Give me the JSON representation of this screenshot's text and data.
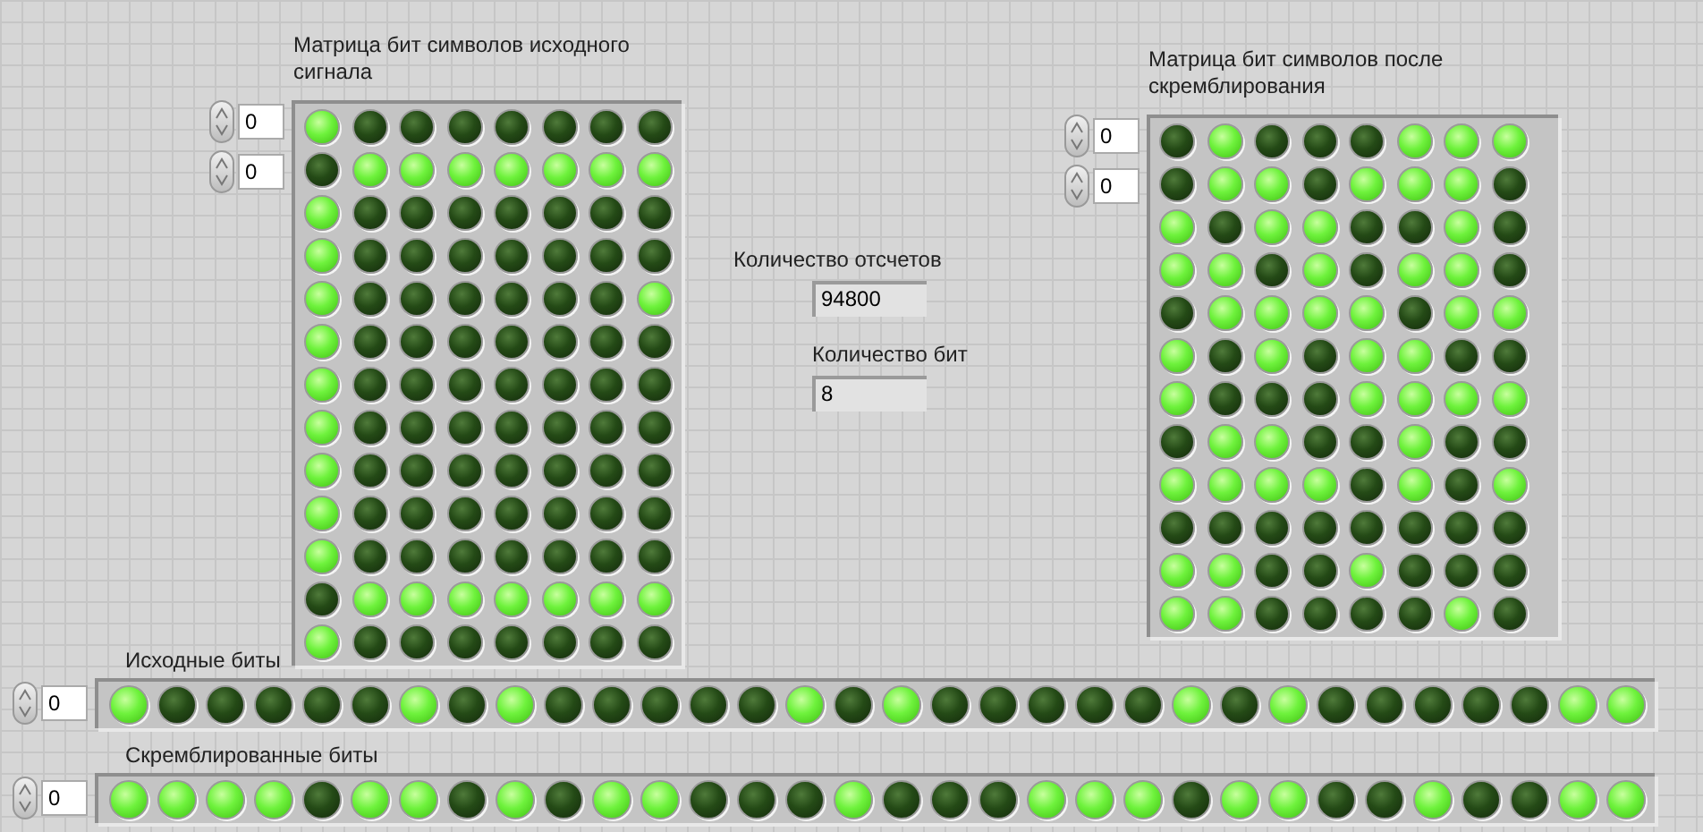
{
  "matrices": [
    {
      "label": "Матрица бит символов исходного сигнала",
      "index": [
        "0",
        "0"
      ],
      "rows": [
        [
          true,
          false,
          false,
          false,
          false,
          false,
          false,
          false
        ],
        [
          false,
          true,
          true,
          true,
          true,
          true,
          true,
          true
        ],
        [
          true,
          false,
          false,
          false,
          false,
          false,
          false,
          false
        ],
        [
          true,
          false,
          false,
          false,
          false,
          false,
          false,
          false
        ],
        [
          true,
          false,
          false,
          false,
          false,
          false,
          false,
          true
        ],
        [
          true,
          false,
          false,
          false,
          false,
          false,
          false,
          false
        ],
        [
          true,
          false,
          false,
          false,
          false,
          false,
          false,
          false
        ],
        [
          true,
          false,
          false,
          false,
          false,
          false,
          false,
          false
        ],
        [
          true,
          false,
          false,
          false,
          false,
          false,
          false,
          false
        ],
        [
          true,
          false,
          false,
          false,
          false,
          false,
          false,
          false
        ],
        [
          true,
          false,
          false,
          false,
          false,
          false,
          false,
          false
        ],
        [
          false,
          true,
          true,
          true,
          true,
          true,
          true,
          true
        ],
        [
          true,
          false,
          false,
          false,
          false,
          false,
          false,
          false
        ]
      ]
    },
    {
      "label": "Матрица бит символов после скремблирования",
      "index": [
        "0",
        "0"
      ],
      "rows": [
        [
          false,
          true,
          false,
          false,
          false,
          true,
          true,
          true
        ],
        [
          false,
          true,
          true,
          false,
          true,
          true,
          true,
          false
        ],
        [
          true,
          false,
          true,
          true,
          false,
          false,
          true,
          false
        ],
        [
          true,
          true,
          false,
          true,
          false,
          true,
          true,
          false
        ],
        [
          false,
          true,
          true,
          true,
          true,
          false,
          true,
          true
        ],
        [
          true,
          false,
          true,
          false,
          true,
          true,
          false,
          false
        ],
        [
          true,
          false,
          false,
          false,
          true,
          true,
          true,
          true
        ],
        [
          false,
          true,
          true,
          false,
          false,
          true,
          false,
          false
        ],
        [
          true,
          true,
          true,
          true,
          false,
          true,
          false,
          true
        ],
        [
          false,
          false,
          false,
          false,
          false,
          false,
          false,
          false
        ],
        [
          true,
          true,
          false,
          false,
          true,
          false,
          false,
          false
        ],
        [
          true,
          true,
          false,
          false,
          false,
          false,
          true,
          false
        ]
      ]
    }
  ],
  "counts": [
    {
      "label": "Количество отсчетов",
      "value": "94800"
    },
    {
      "label": "Количество бит",
      "value": "8"
    }
  ],
  "arrays": [
    {
      "label": "Исходные биты",
      "index": "0",
      "bits": [
        true,
        false,
        false,
        false,
        false,
        false,
        true,
        false,
        true,
        false,
        false,
        false,
        false,
        false,
        true,
        false,
        true,
        false,
        false,
        false,
        false,
        false,
        true,
        false,
        true,
        false,
        false,
        false,
        false,
        false,
        true,
        true
      ]
    },
    {
      "label": "Скремблированные биты",
      "index": "0",
      "bits": [
        true,
        true,
        true,
        true,
        false,
        true,
        true,
        false,
        true,
        false,
        true,
        true,
        false,
        false,
        false,
        true,
        false,
        false,
        false,
        true,
        true,
        true,
        false,
        true,
        true,
        false,
        false,
        true,
        false,
        false,
        true,
        true
      ]
    }
  ]
}
